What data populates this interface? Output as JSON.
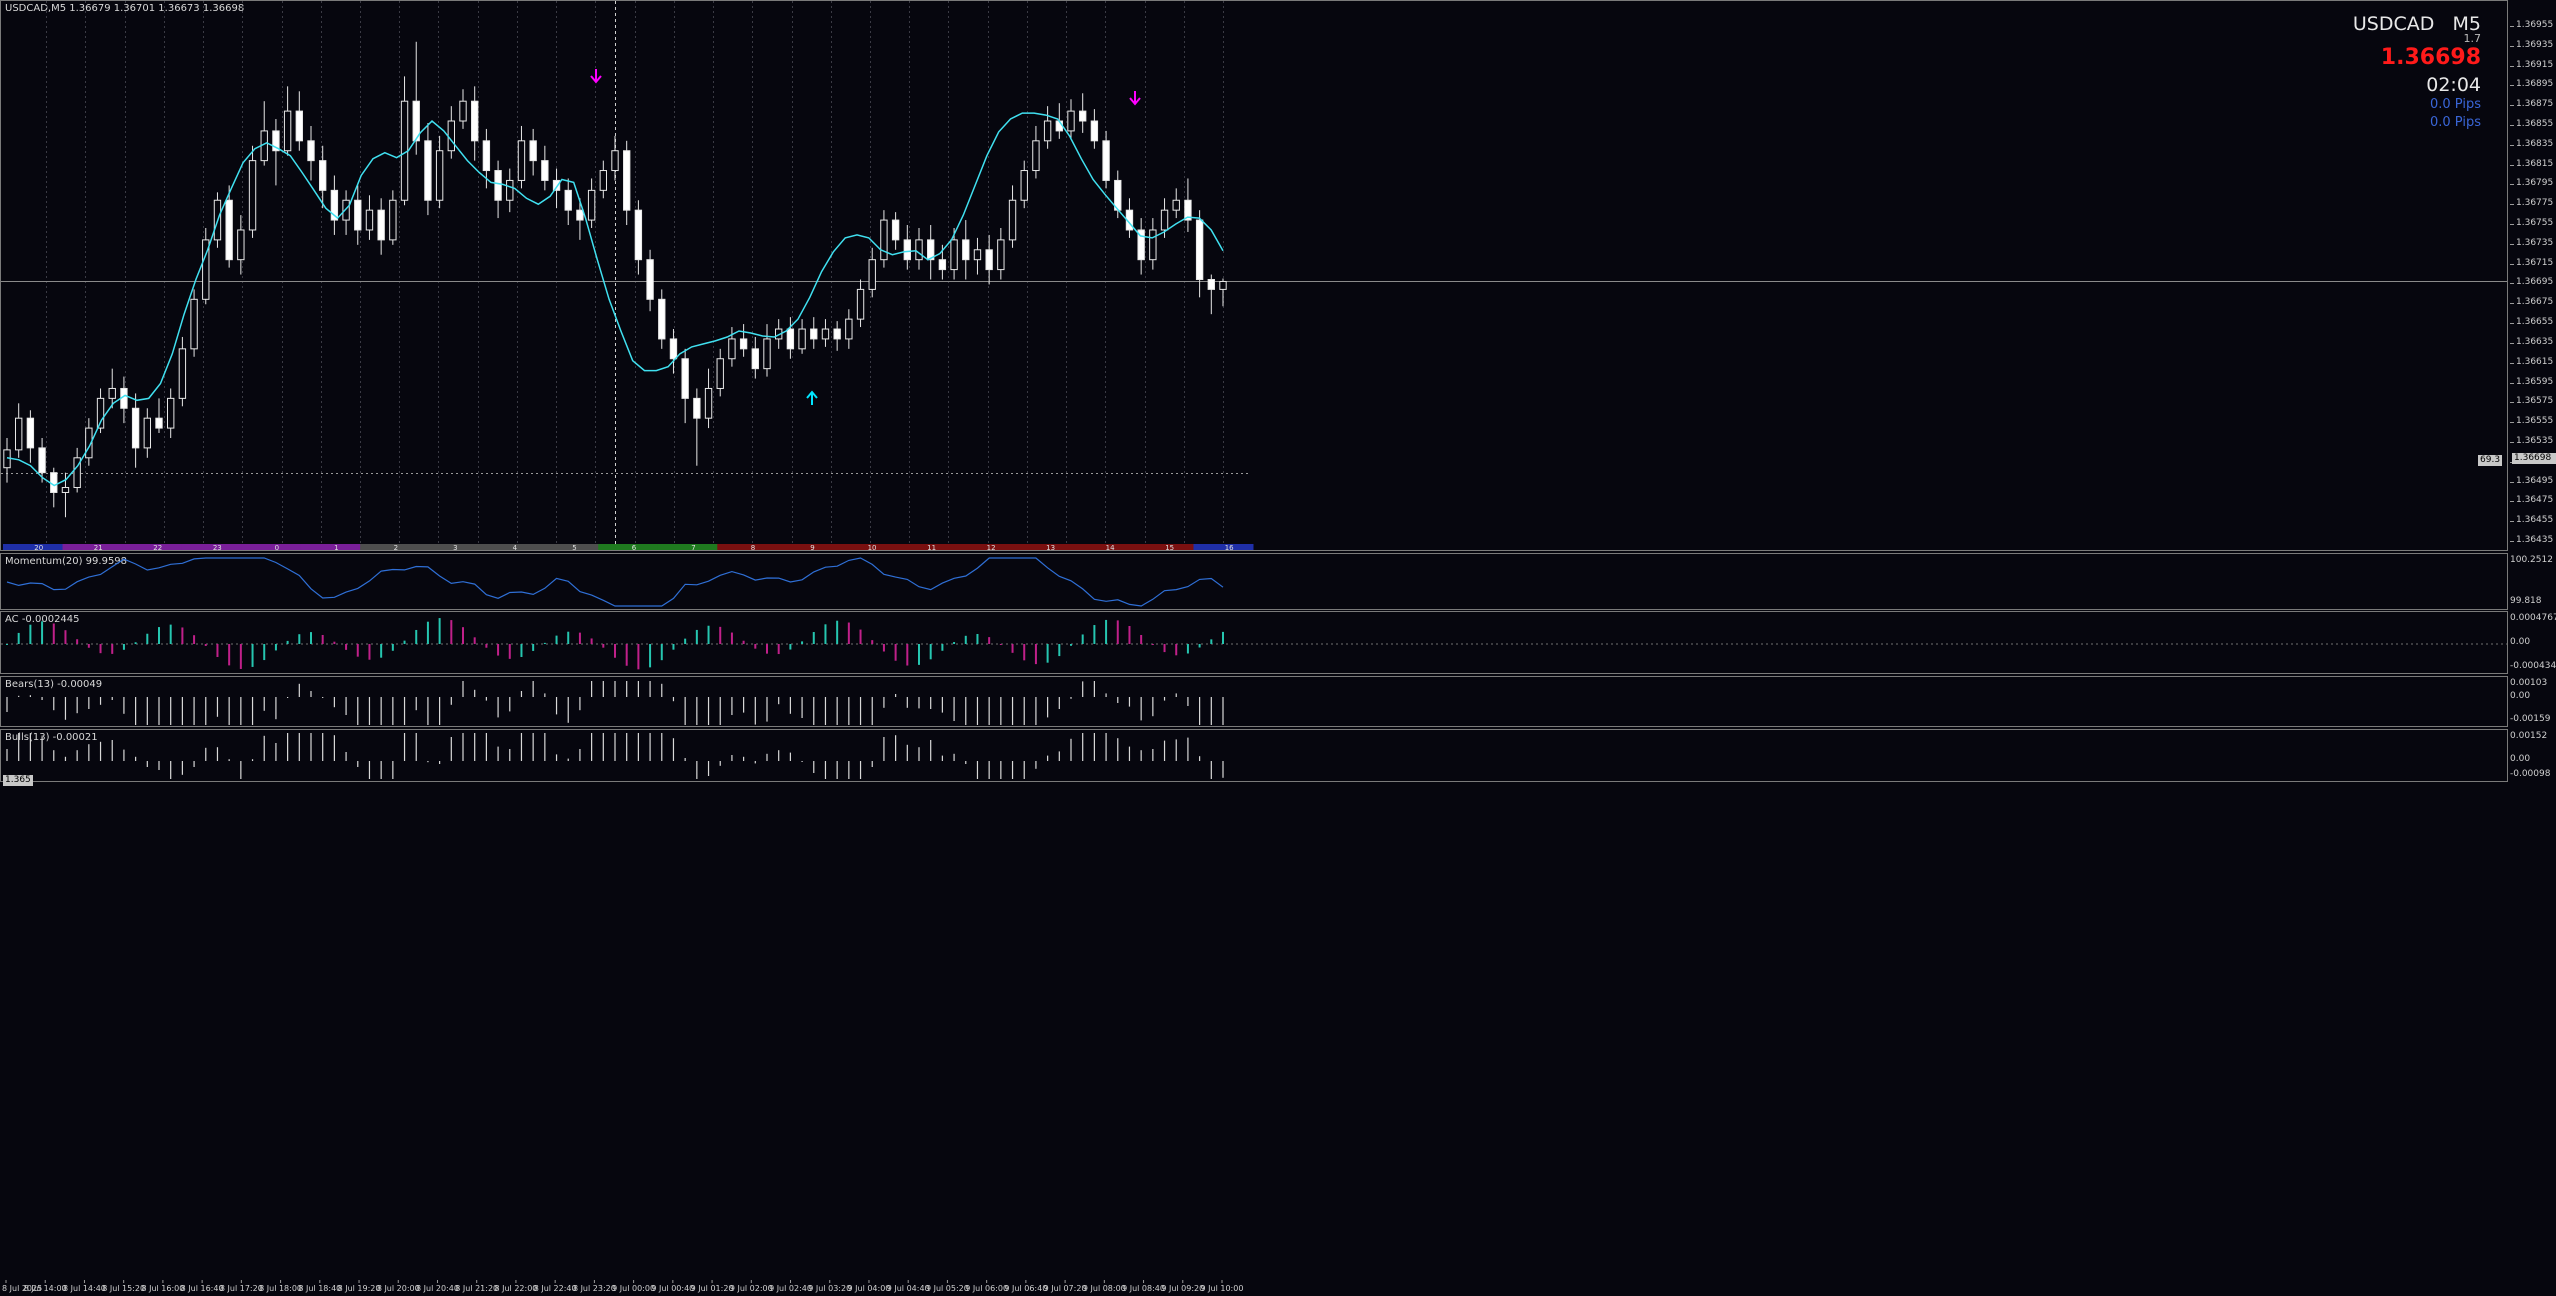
{
  "window": {
    "header": "USDCAD,M5  1.36679 1.36701 1.36673 1.36698"
  },
  "info_panel": {
    "symbol": "USDCAD",
    "timeframe": "M5",
    "spread": "1.7",
    "price": "1.36698",
    "timer": "02:04",
    "pips1": "0.0 Pips",
    "pips2": "0.0 Pips"
  },
  "colors": {
    "background": "#06060e",
    "ma_line": "#40e0f0",
    "sell_arrow": "#ff00ff",
    "buy_arrow": "#00e5ff",
    "price_text": "#ff1a1a",
    "ac_up": "#26c6b0",
    "ac_down": "#c0208a",
    "momentum_line": "#2f6fd6"
  },
  "price_axis": {
    "labels": [
      "1.36955",
      "1.36935",
      "1.36915",
      "1.36895",
      "1.36875",
      "1.36855",
      "1.36835",
      "1.36815",
      "1.36795",
      "1.36775",
      "1.36755",
      "1.36735",
      "1.36715",
      "1.36695",
      "1.36675",
      "1.36655",
      "1.36635",
      "1.36615",
      "1.36595",
      "1.36575",
      "1.36555",
      "1.36535",
      "1.36515",
      "1.36495",
      "1.36475",
      "1.36455",
      "1.36435"
    ],
    "current_price_tag": "1.36698",
    "line_tag": "69.3",
    "left_level_tag": "1.365"
  },
  "hour_bar": {
    "labels": [
      "20",
      "21",
      "22",
      "23",
      "0",
      "1",
      "2",
      "3",
      "4",
      "5",
      "6",
      "7",
      "8",
      "9",
      "10",
      "11",
      "12",
      "13",
      "14",
      "15",
      "16"
    ]
  },
  "indicators": {
    "momentum": {
      "label": "Momentum(20) 99.9598",
      "top": "100.2512",
      "bottom": "99.818"
    },
    "ac": {
      "label": "AC -0.0002445",
      "top": "0.0004767",
      "mid": "0.00",
      "bottom": "-0.000434"
    },
    "bears": {
      "label": "Bears(13) -0.00049",
      "top": "0.00103",
      "mid": "0.00",
      "bottom": "-0.00159"
    },
    "bulls": {
      "label": "Bulls(13) -0.00021",
      "top": "0.00152",
      "mid": "0.00",
      "bottom": "-0.00098"
    }
  },
  "time_axis": {
    "labels": [
      "8 Jul 2025",
      "8 Jul 14:00",
      "8 Jul 14:40",
      "8 Jul 15:20",
      "8 Jul 16:00",
      "8 Jul 16:40",
      "8 Jul 17:20",
      "8 Jul 18:00",
      "8 Jul 18:40",
      "8 Jul 19:20",
      "8 Jul 20:00",
      "8 Jul 20:40",
      "8 Jul 21:20",
      "8 Jul 22:00",
      "8 Jul 22:40",
      "8 Jul 23:20",
      "9 Jul 00:00",
      "9 Jul 00:40",
      "9 Jul 01:20",
      "9 Jul 02:00",
      "9 Jul 02:40",
      "9 Jul 03:20",
      "9 Jul 04:00",
      "9 Jul 04:40",
      "9 Jul 05:20",
      "9 Jul 06:00",
      "9 Jul 06:40",
      "9 Jul 07:20",
      "9 Jul 08:00",
      "9 Jul 08:40",
      "9 Jul 09:20",
      "9 Jul 10:00"
    ]
  },
  "chart_data": {
    "type": "candlestick",
    "symbol": "USDCAD",
    "timeframe": "M5",
    "ylim": [
      1.36435,
      1.36965
    ],
    "ma_series": [
      1.3652,
      1.36518,
      1.36512,
      1.365,
      1.36492,
      1.36498,
      1.36512,
      1.36532,
      1.36558,
      1.36575,
      1.36583,
      1.36578,
      1.3658,
      1.36595,
      1.36625,
      1.36665,
      1.367,
      1.3673,
      1.36765,
      1.36792,
      1.36818,
      1.36832,
      1.36838,
      1.36832,
      1.36825,
      1.36808,
      1.3679,
      1.36772,
      1.36762,
      1.36775,
      1.36805,
      1.36822,
      1.36828,
      1.36823,
      1.3683,
      1.36848,
      1.3686,
      1.3685,
      1.36835,
      1.3682,
      1.36808,
      1.36798,
      1.36796,
      1.36792,
      1.36782,
      1.36776,
      1.36784,
      1.36801,
      1.36798,
      1.36762,
      1.3672,
      1.3668,
      1.36648,
      1.36618,
      1.36608,
      1.36608,
      1.36612,
      1.36625,
      1.36632,
      1.36635,
      1.36638,
      1.36642,
      1.36648,
      1.36646,
      1.36643,
      1.36642,
      1.36648,
      1.3666,
      1.36682,
      1.36708,
      1.36728,
      1.36742,
      1.36745,
      1.36742,
      1.3673,
      1.36725,
      1.36728,
      1.36729,
      1.3672,
      1.36726,
      1.3674,
      1.36765,
      1.36795,
      1.36825,
      1.36849,
      1.36862,
      1.36868,
      1.36868,
      1.36866,
      1.36862,
      1.36845,
      1.36822,
      1.36801,
      1.36786,
      1.36772,
      1.36758,
      1.36744,
      1.36742,
      1.36748,
      1.36756,
      1.36763,
      1.36762,
      1.3675,
      1.36729
    ],
    "bars": [
      [
        1.3651,
        1.36528,
        1.3654,
        1.36495
      ],
      [
        1.36528,
        1.3656,
        1.36575,
        1.3652
      ],
      [
        1.3656,
        1.3653,
        1.36568,
        1.36515
      ],
      [
        1.3653,
        1.36505,
        1.3654,
        1.36495
      ],
      [
        1.36505,
        1.36485,
        1.3651,
        1.3647
      ],
      [
        1.36485,
        1.3649,
        1.36505,
        1.3646
      ],
      [
        1.3649,
        1.3652,
        1.3653,
        1.36485
      ],
      [
        1.3652,
        1.3655,
        1.3656,
        1.36512
      ],
      [
        1.3655,
        1.3658,
        1.3659,
        1.36545
      ],
      [
        1.3658,
        1.3659,
        1.3661,
        1.3657
      ],
      [
        1.3659,
        1.3657,
        1.36602,
        1.36555
      ],
      [
        1.3657,
        1.3653,
        1.36585,
        1.3651
      ],
      [
        1.3653,
        1.3656,
        1.3657,
        1.3652
      ],
      [
        1.3656,
        1.3655,
        1.3658,
        1.36545
      ],
      [
        1.3655,
        1.3658,
        1.3659,
        1.3654
      ],
      [
        1.3658,
        1.3663,
        1.36642,
        1.36572
      ],
      [
        1.3663,
        1.3668,
        1.3669,
        1.36622
      ],
      [
        1.3668,
        1.3674,
        1.36752,
        1.36675
      ],
      [
        1.3674,
        1.3678,
        1.36788,
        1.36732
      ],
      [
        1.3678,
        1.3672,
        1.36795,
        1.36712
      ],
      [
        1.3672,
        1.3675,
        1.36765,
        1.36705
      ],
      [
        1.3675,
        1.3682,
        1.36835,
        1.36742
      ],
      [
        1.3682,
        1.3685,
        1.3688,
        1.36815
      ],
      [
        1.3685,
        1.3683,
        1.36862,
        1.36795
      ],
      [
        1.3683,
        1.3687,
        1.36895,
        1.36825
      ],
      [
        1.3687,
        1.3684,
        1.3689,
        1.3683
      ],
      [
        1.3684,
        1.3682,
        1.36855,
        1.368
      ],
      [
        1.3682,
        1.3679,
        1.36835,
        1.36772
      ],
      [
        1.3679,
        1.3676,
        1.36805,
        1.36745
      ],
      [
        1.3676,
        1.3678,
        1.3679,
        1.36745
      ],
      [
        1.3678,
        1.3675,
        1.36795,
        1.36735
      ],
      [
        1.3675,
        1.3677,
        1.36785,
        1.3674
      ],
      [
        1.3677,
        1.3674,
        1.36782,
        1.36725
      ],
      [
        1.3674,
        1.3678,
        1.3679,
        1.36735
      ],
      [
        1.3678,
        1.3688,
        1.36905,
        1.36775
      ],
      [
        1.3688,
        1.3684,
        1.3694,
        1.36826
      ],
      [
        1.3684,
        1.3678,
        1.36858,
        1.36765
      ],
      [
        1.3678,
        1.3683,
        1.36845,
        1.36772
      ],
      [
        1.3683,
        1.3686,
        1.36875,
        1.36822
      ],
      [
        1.3686,
        1.3688,
        1.36892,
        1.36852
      ],
      [
        1.3688,
        1.3684,
        1.36895,
        1.3682
      ],
      [
        1.3684,
        1.3681,
        1.36852,
        1.36792
      ],
      [
        1.3681,
        1.3678,
        1.3682,
        1.36762
      ],
      [
        1.3678,
        1.368,
        1.36812,
        1.36768
      ],
      [
        1.368,
        1.3684,
        1.36855,
        1.36792
      ],
      [
        1.3684,
        1.3682,
        1.36852,
        1.36805
      ],
      [
        1.3682,
        1.368,
        1.36835,
        1.3679
      ],
      [
        1.368,
        1.3679,
        1.36812,
        1.36772
      ],
      [
        1.3679,
        1.3677,
        1.36802,
        1.36755
      ],
      [
        1.3677,
        1.3676,
        1.36782,
        1.3674
      ],
      [
        1.3676,
        1.3679,
        1.36802,
        1.36752
      ],
      [
        1.3679,
        1.3681,
        1.3682,
        1.36782
      ],
      [
        1.3681,
        1.3683,
        1.36845,
        1.368
      ],
      [
        1.3683,
        1.3677,
        1.3684,
        1.36755
      ],
      [
        1.3677,
        1.3672,
        1.3678,
        1.36705
      ],
      [
        1.3672,
        1.3668,
        1.3673,
        1.36668
      ],
      [
        1.3668,
        1.3664,
        1.3669,
        1.3663
      ],
      [
        1.3664,
        1.3662,
        1.3665,
        1.36605
      ],
      [
        1.3662,
        1.3658,
        1.3663,
        1.36555
      ],
      [
        1.3658,
        1.3656,
        1.3659,
        1.36512
      ],
      [
        1.3656,
        1.3659,
        1.3661,
        1.3655
      ],
      [
        1.3659,
        1.3662,
        1.3663,
        1.36582
      ],
      [
        1.3662,
        1.3664,
        1.36652,
        1.36612
      ],
      [
        1.3664,
        1.3663,
        1.36655,
        1.36622
      ],
      [
        1.3663,
        1.3661,
        1.36642,
        1.366
      ],
      [
        1.3661,
        1.3664,
        1.36655,
        1.36602
      ],
      [
        1.3664,
        1.3665,
        1.3666,
        1.3663
      ],
      [
        1.3665,
        1.3663,
        1.36662,
        1.3662
      ],
      [
        1.3663,
        1.3665,
        1.3666,
        1.36625
      ],
      [
        1.3665,
        1.3664,
        1.36662,
        1.3663
      ],
      [
        1.3664,
        1.3665,
        1.3666,
        1.36632
      ],
      [
        1.3665,
        1.3664,
        1.36658,
        1.36628
      ],
      [
        1.3664,
        1.3666,
        1.3667,
        1.3663
      ],
      [
        1.3666,
        1.3669,
        1.367,
        1.36652
      ],
      [
        1.3669,
        1.3672,
        1.36732,
        1.36682
      ],
      [
        1.3672,
        1.3676,
        1.3677,
        1.36712
      ],
      [
        1.3676,
        1.3674,
        1.36768,
        1.3673
      ],
      [
        1.3674,
        1.3672,
        1.36755,
        1.3671
      ],
      [
        1.3672,
        1.3674,
        1.36752,
        1.3671
      ],
      [
        1.3674,
        1.3672,
        1.36755,
        1.367
      ],
      [
        1.3672,
        1.3671,
        1.36735,
        1.367
      ],
      [
        1.3671,
        1.3674,
        1.36752,
        1.367
      ],
      [
        1.3674,
        1.3672,
        1.3676,
        1.367
      ],
      [
        1.3672,
        1.3673,
        1.36742,
        1.36705
      ],
      [
        1.3673,
        1.3671,
        1.36745,
        1.36695
      ],
      [
        1.3671,
        1.3674,
        1.36752,
        1.367
      ],
      [
        1.3674,
        1.3678,
        1.36795,
        1.36732
      ],
      [
        1.3678,
        1.3681,
        1.3682,
        1.36772
      ],
      [
        1.3681,
        1.3684,
        1.36855,
        1.36802
      ],
      [
        1.3684,
        1.3686,
        1.36875,
        1.36832
      ],
      [
        1.3686,
        1.3685,
        1.36878,
        1.36842
      ],
      [
        1.3685,
        1.3687,
        1.36882,
        1.36842
      ],
      [
        1.3687,
        1.3686,
        1.36888,
        1.36848
      ],
      [
        1.3686,
        1.3684,
        1.36872,
        1.36832
      ],
      [
        1.3684,
        1.368,
        1.3685,
        1.36792
      ],
      [
        1.368,
        1.3677,
        1.3681,
        1.36762
      ],
      [
        1.3677,
        1.3675,
        1.36782,
        1.36742
      ],
      [
        1.3675,
        1.3672,
        1.36762,
        1.36705
      ],
      [
        1.3672,
        1.3675,
        1.36762,
        1.3671
      ],
      [
        1.3675,
        1.3677,
        1.36782,
        1.36742
      ],
      [
        1.3677,
        1.3678,
        1.36792,
        1.36762
      ],
      [
        1.3678,
        1.3676,
        1.36802,
        1.36748
      ],
      [
        1.3676,
        1.367,
        1.3677,
        1.36682
      ],
      [
        1.367,
        1.3669,
        1.36705,
        1.36665
      ],
      [
        1.3669,
        1.36698,
        1.36701,
        1.36673
      ]
    ]
  }
}
